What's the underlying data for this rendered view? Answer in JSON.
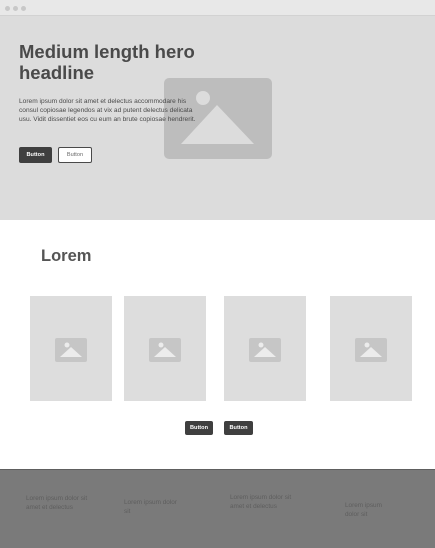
{
  "hero": {
    "headline": "Medium length hero headline",
    "body": "Lorem ipsum dolor sit amet et delectus accommodare his consul copiosae legendos at vix ad putent delectus delicata usu. Vidit dissentiet eos cu eum an brute copiosae hendrerit.",
    "primary_button": "Button",
    "secondary_button": "Button",
    "image_icon": "image-placeholder-icon"
  },
  "section": {
    "title": "Lorem",
    "card_icon": "image-placeholder-icon",
    "buttons": [
      "Button",
      "Button"
    ]
  },
  "footer": {
    "columns": [
      "Lorem ipsum dolor sit amet et delectus",
      "Lorem ipsum dolor sit",
      "Lorem ipsum dolor sit amet et delectus",
      "Lorem ipsum dolor sit"
    ]
  },
  "colors": {
    "hero_bg": "#dcdcdc",
    "button_dark": "#3f3f3f",
    "footer_bg": "#7a7a7a"
  }
}
